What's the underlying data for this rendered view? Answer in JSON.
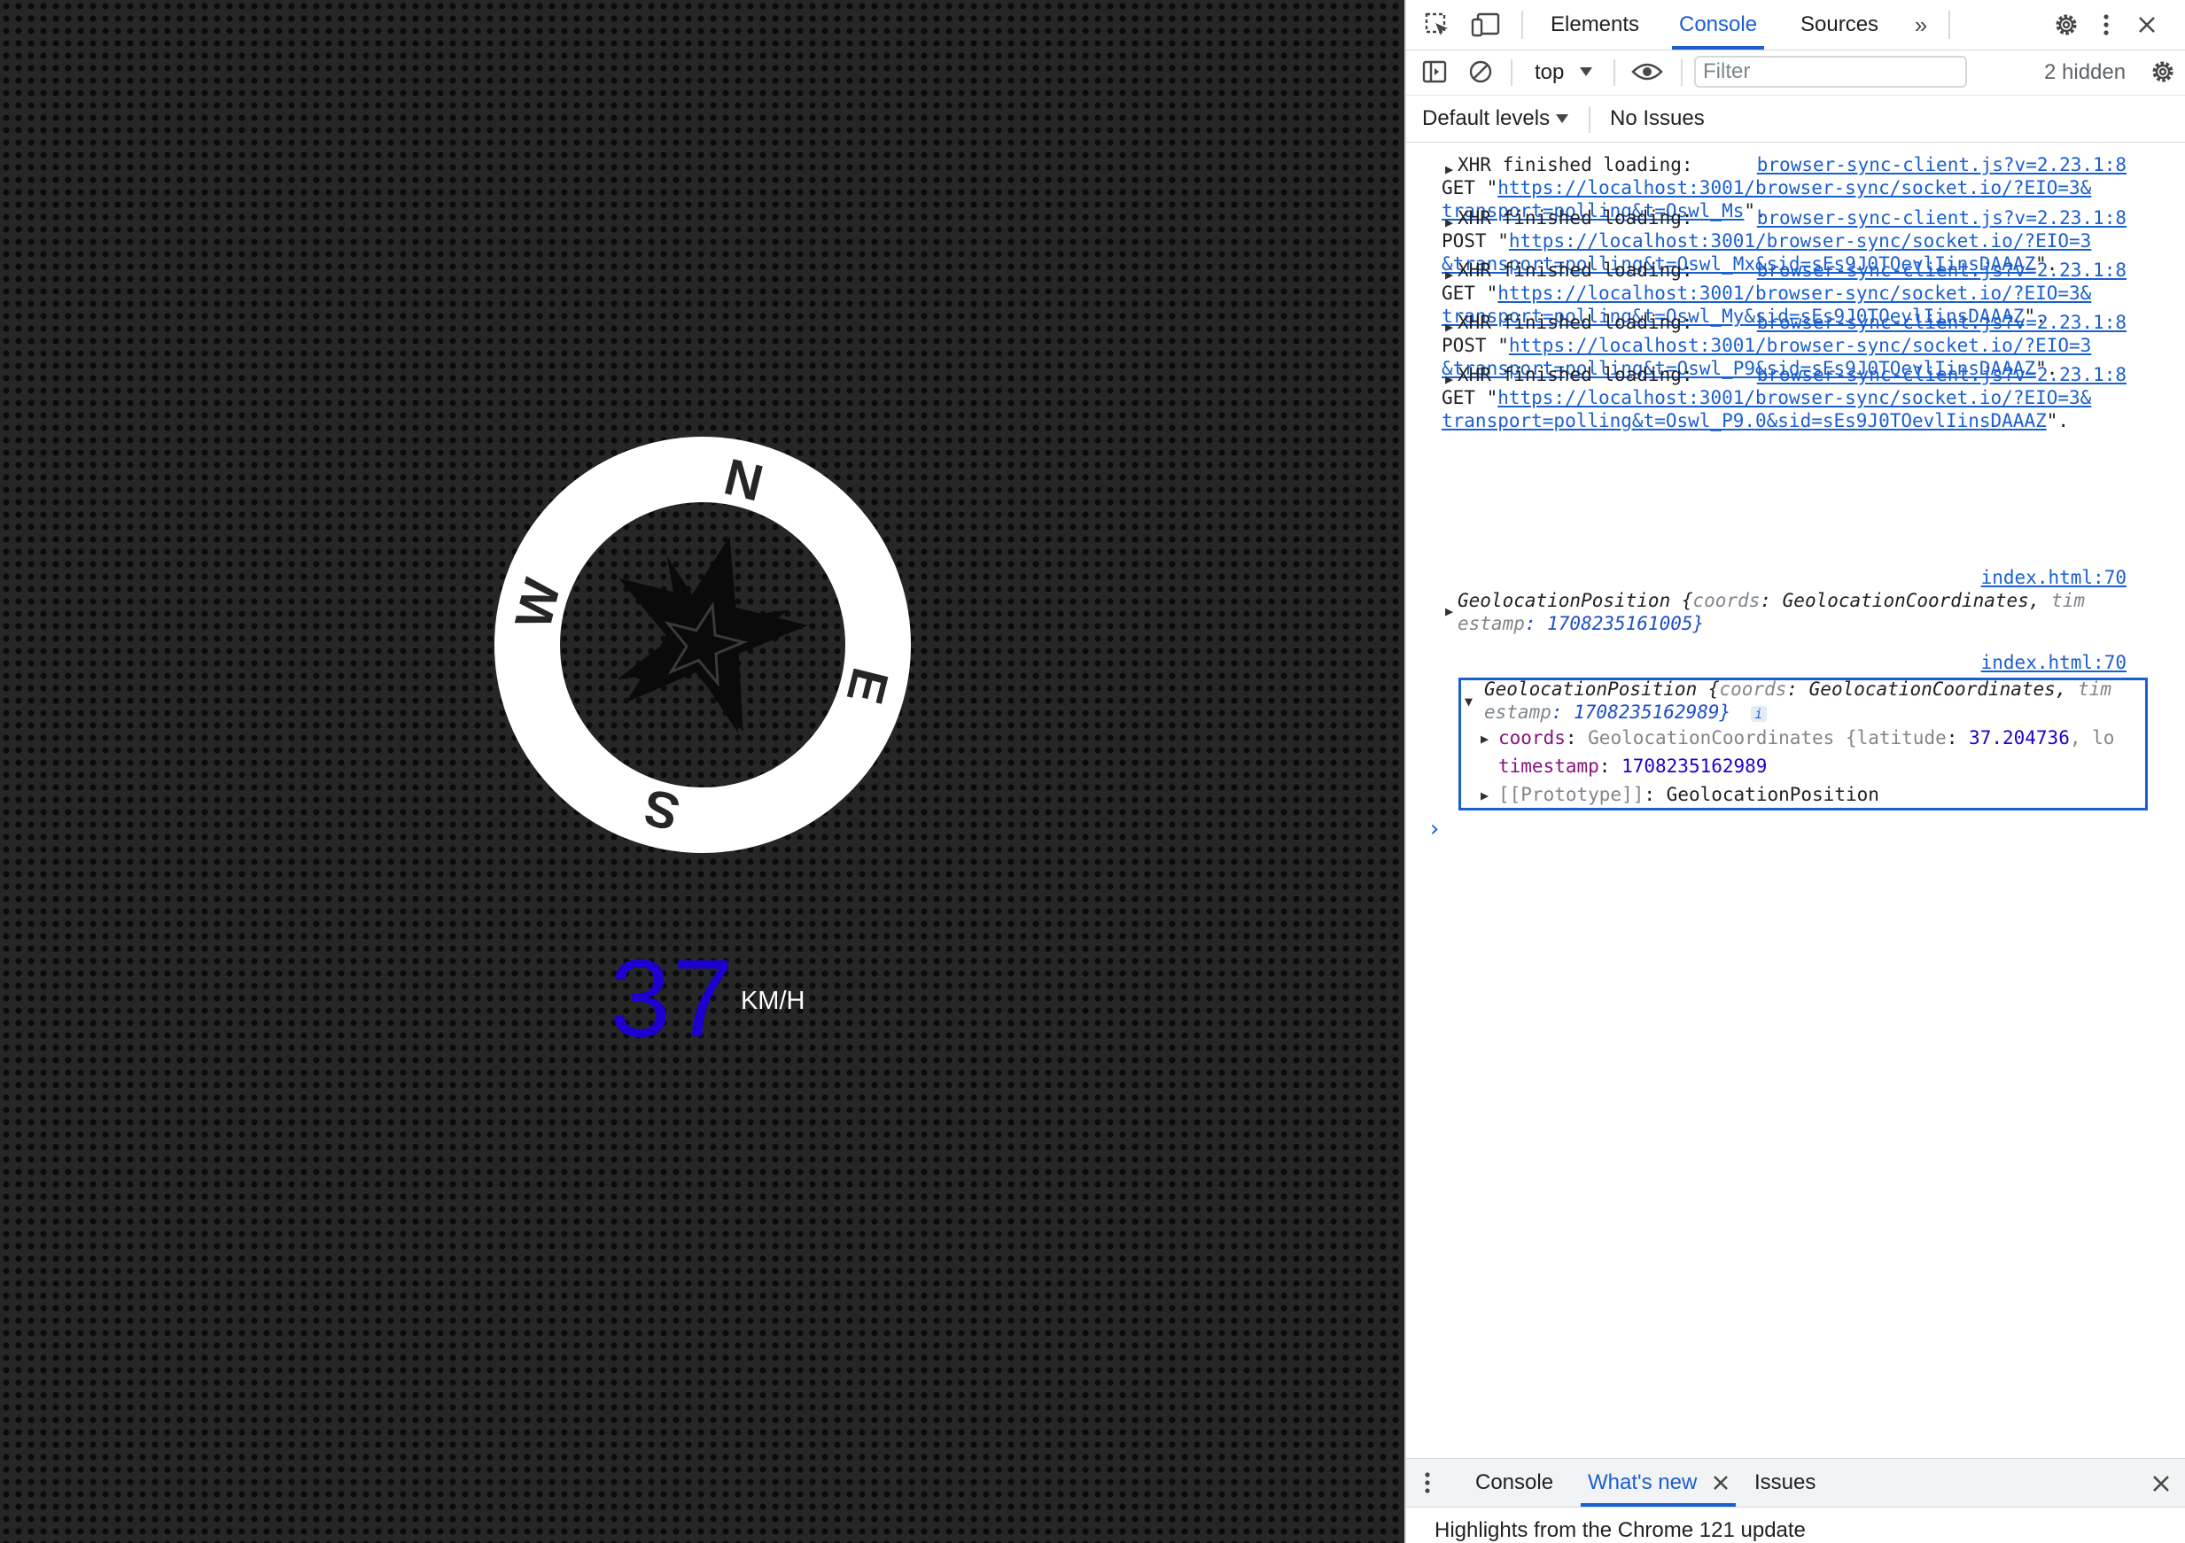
{
  "app": {
    "speed": "37",
    "speed_unit": "KM/H",
    "compass_letters": {
      "n": "N",
      "e": "E",
      "s": "S",
      "w": "W"
    }
  },
  "devtools": {
    "tabs": [
      "Elements",
      "Console",
      "Sources"
    ],
    "active_tab": "Console",
    "toolbar": {
      "context": "top",
      "filter_placeholder": "Filter",
      "hidden_count": "2 hidden"
    },
    "levels": {
      "label": "Default levels",
      "issues": "No Issues"
    },
    "messages": [
      {
        "prefix": "XHR finished loading: ",
        "source": "browser-sync-client.js?v=2.23.1:8",
        "method": "GET ",
        "url_line1": "https://localhost:3001/browser-sync/socket.io/?EIO=3&",
        "url_line2": "transport=polling&t=Oswl_Ms",
        "suffix": "\"."
      },
      {
        "prefix": "XHR finished loading: ",
        "source": "browser-sync-client.js?v=2.23.1:8",
        "method": "POST ",
        "url_line1": "https://localhost:3001/browser-sync/socket.io/?EIO=3",
        "url_line2": "&transport=polling&t=Oswl_Mx&sid=sEs9J0TOevlIinsDAAAZ",
        "suffix": "\"."
      },
      {
        "prefix": "XHR finished loading: ",
        "source": "browser-sync-client.js?v=2.23.1:8",
        "method": "GET ",
        "url_line1": "https://localhost:3001/browser-sync/socket.io/?EIO=3&",
        "url_line2": "transport=polling&t=Oswl_My&sid=sEs9J0TOevlIinsDAAAZ",
        "suffix": "\"."
      },
      {
        "prefix": "XHR finished loading: ",
        "source": "browser-sync-client.js?v=2.23.1:8",
        "method": "POST ",
        "url_line1": "https://localhost:3001/browser-sync/socket.io/?EIO=3",
        "url_line2": "&transport=polling&t=Oswl_P9&sid=sEs9J0TOevlIinsDAAAZ",
        "suffix": "\"."
      },
      {
        "prefix": "XHR finished loading: ",
        "source": "browser-sync-client.js?v=2.23.1:8",
        "method": "GET ",
        "url_line1": "https://localhost:3001/browser-sync/socket.io/?EIO=3&",
        "url_line2": "transport=polling&t=Oswl_P9.0&sid=sEs9J0TOevlIinsDAAAZ",
        "suffix": "\"."
      }
    ],
    "geo1": {
      "source": "index.html:70",
      "line1_a": "GeolocationPosition {",
      "line1_key": "coords",
      "line1_b": ": GeolocationCoordinates, ",
      "line1_c": "tim",
      "line2_a": "estamp",
      "line2_b": ": 1708235161005}"
    },
    "geo2": {
      "source": "index.html:70",
      "line1_a": "GeolocationPosition {",
      "line1_key": "coords",
      "line1_b": ": GeolocationCoordinates, ",
      "line1_c": "tim",
      "line2_a": "estamp",
      "line2_b": ": 1708235162989}",
      "info_badge": "i",
      "coords_key": "coords",
      "coords_val": "GeolocationCoordinates {",
      "coords_lat_key": "latitude",
      "coords_lat_val": "37.204736",
      "coords_tail": ", lo",
      "timestamp_key": "timestamp",
      "timestamp_val": "1708235162989",
      "proto_key": "[[Prototype]]",
      "proto_val": "GeolocationPosition"
    },
    "drawer": {
      "tabs": [
        "Console",
        "What's new",
        "Issues"
      ],
      "active_tab": "What's new",
      "content": "Highlights from the Chrome 121 update"
    }
  },
  "colors": {
    "accent": "#1a5fd0",
    "app_bg": "#262626",
    "speed_text": "#ffffff"
  }
}
